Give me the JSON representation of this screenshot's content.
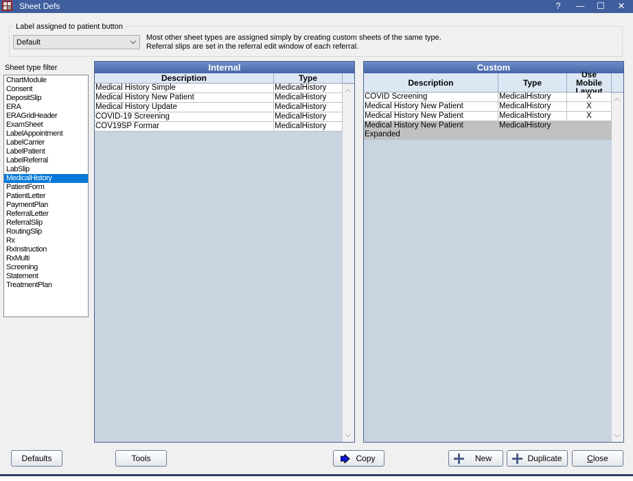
{
  "window": {
    "title": "Sheet Defs",
    "help_label": "?",
    "minimize_label": "—",
    "maximize_label": "☐",
    "close_label": "✕"
  },
  "patient_button": {
    "group_label": "Label assigned to patient button",
    "selected": "Default",
    "info_line1": "Most other sheet types are assigned simply by creating custom sheets of the same type.",
    "info_line2": "Referral slips are set in the referral edit window of each referral."
  },
  "filter": {
    "label": "Sheet type filter",
    "items": [
      "ChartModule",
      "Consent",
      "DepositSlip",
      "ERA",
      "ERAGridHeader",
      "ExamSheet",
      "LabelAppointment",
      "LabelCarrier",
      "LabelPatient",
      "LabelReferral",
      "LabSlip",
      "MedicalHistory",
      "PatientForm",
      "PatientLetter",
      "PaymentPlan",
      "ReferralLetter",
      "ReferralSlip",
      "RoutingSlip",
      "Rx",
      "RxInstruction",
      "RxMulti",
      "Screening",
      "Statement",
      "TreatmentPlan"
    ],
    "selected": "MedicalHistory"
  },
  "internal": {
    "title": "Internal",
    "columns": [
      "Description",
      "Type"
    ],
    "rows": [
      [
        "Medical History Simple",
        "MedicalHistory"
      ],
      [
        "Medical History New Patient",
        "MedicalHistory"
      ],
      [
        "Medical History Update",
        "MedicalHistory"
      ],
      [
        "COVID-19 Screening",
        "MedicalHistory"
      ],
      [
        "COV19SP Formar",
        "MedicalHistory"
      ]
    ]
  },
  "custom": {
    "title": "Custom",
    "columns": [
      "Description",
      "Type",
      "Use Mobile Layout"
    ],
    "rows": [
      [
        "COVID Screening",
        "MedicalHistory",
        "X"
      ],
      [
        "Medical History New Patient",
        "MedicalHistory",
        "X"
      ],
      [
        "Medical History New Patient",
        "MedicalHistory",
        "X"
      ],
      [
        "Medical History New Patient Expanded",
        "MedicalHistory",
        ""
      ]
    ],
    "selected_row": 3
  },
  "buttons": {
    "defaults": "Defaults",
    "tools": "Tools",
    "copy": "Copy",
    "new": "New",
    "duplicate": "Duplicate",
    "close": "Close"
  },
  "colors": {
    "titlebar": "#3e5e9e",
    "grid_header": "#4566a8",
    "selection": "#0078d7",
    "grid_bg": "#c8d4df"
  }
}
